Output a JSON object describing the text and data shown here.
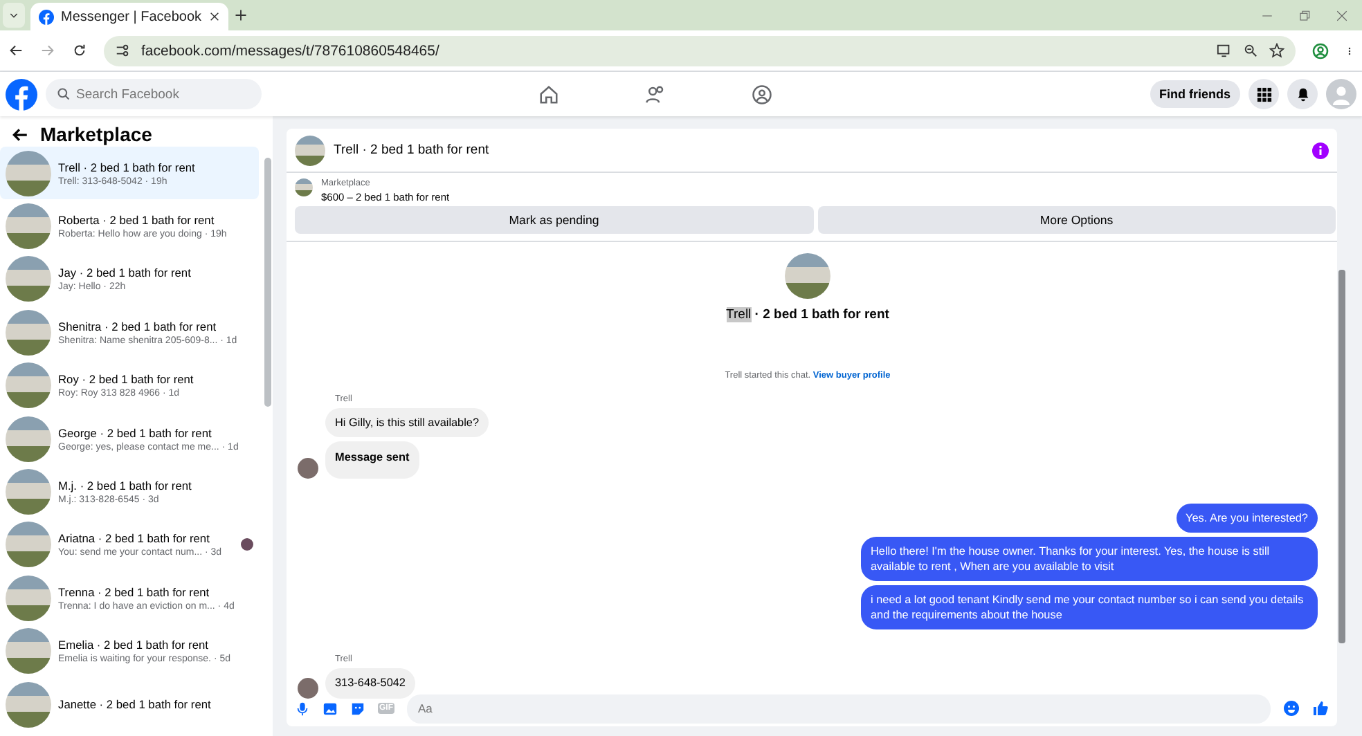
{
  "browser": {
    "tab_title": "Messenger | Facebook",
    "url": "facebook.com/messages/t/787610860548465/"
  },
  "header": {
    "search_placeholder": "Search Facebook",
    "find_friends": "Find friends"
  },
  "sidebar": {
    "title": "Marketplace",
    "items": [
      {
        "name": "Trell · 2 bed 1 bath for rent",
        "preview": "Trell: 313-648-5042 · 19h",
        "selected": true,
        "seen": false
      },
      {
        "name": "Roberta · 2 bed 1 bath for rent",
        "preview": "Roberta: Hello how are you doing · 19h",
        "selected": false,
        "seen": false
      },
      {
        "name": "Jay · 2 bed 1 bath for rent",
        "preview": "Jay: Hello · 22h",
        "selected": false,
        "seen": false
      },
      {
        "name": "Shenitra · 2 bed 1 bath for rent",
        "preview": "Shenitra: Name shenitra 205-609-8... · 1d",
        "selected": false,
        "seen": false
      },
      {
        "name": "Roy · 2 bed 1 bath for rent",
        "preview": "Roy: Roy 313 828 4966 · 1d",
        "selected": false,
        "seen": false
      },
      {
        "name": "George · 2 bed 1 bath for rent",
        "preview": "George: yes, please contact me me... · 1d",
        "selected": false,
        "seen": false
      },
      {
        "name": "M.j. · 2 bed 1 bath for rent",
        "preview": "M.j.: 313-828-6545 · 3d",
        "selected": false,
        "seen": false
      },
      {
        "name": "Ariatna · 2 bed 1 bath for rent",
        "preview": "You: send me your contact num... · 3d",
        "selected": false,
        "seen": true
      },
      {
        "name": "Trenna · 2 bed 1 bath for rent",
        "preview": "Trenna: I do have an eviction on m... · 4d",
        "selected": false,
        "seen": false
      },
      {
        "name": "Emelia · 2 bed 1 bath for rent",
        "preview": "Emelia is waiting for your response. · 5d",
        "selected": false,
        "seen": false
      },
      {
        "name": "Janette · 2 bed 1 bath for rent",
        "selected": false,
        "seen": false
      }
    ]
  },
  "chat": {
    "title": "Trell · 2 bed 1 bath for rent",
    "listing_label": "Marketplace",
    "listing_price": "$600 – 2 bed 1 bath for rent",
    "buttons": [
      "Mark as pending",
      "More Options"
    ],
    "intro_name": "Trell",
    "intro_rest": " · 2 bed 1 bath for rent",
    "started_text": "Trell started this chat.",
    "profile_link": "View buyer profile",
    "messages": [
      {
        "kind": "sender",
        "text": "Trell"
      },
      {
        "kind": "incoming",
        "text": "Hi Gilly, is this still available?",
        "bold": false,
        "avatar": false
      },
      {
        "kind": "incoming",
        "text": "Message sent",
        "bold": true,
        "avatar": true
      },
      {
        "kind": "outgoing",
        "text": "Yes. Are you interested?"
      },
      {
        "kind": "outgoing",
        "text": "Hello there! I'm the house owner. Thanks for your interest. Yes, the house is still available to rent , When are you available to visit"
      },
      {
        "kind": "outgoing",
        "text": "i need a lot good tenant Kindly send me your contact number so i can send you details and the requirements about the house"
      },
      {
        "kind": "sender",
        "text": "Trell"
      },
      {
        "kind": "incoming",
        "text": "313-648-5042",
        "bold": false,
        "avatar": true
      }
    ],
    "composer_placeholder": "Aa",
    "gif": "GIF"
  }
}
